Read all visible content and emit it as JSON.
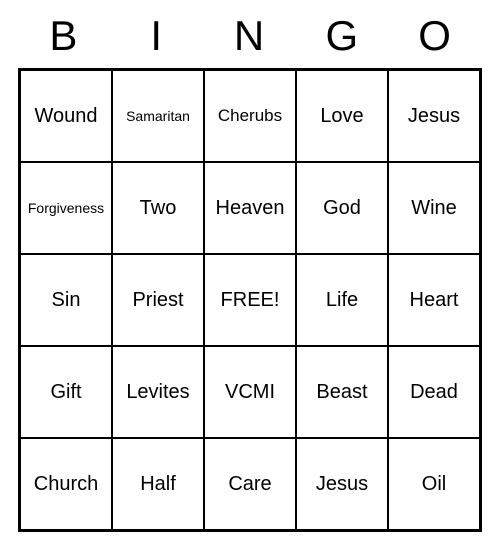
{
  "header": [
    "B",
    "I",
    "N",
    "G",
    "O"
  ],
  "grid": {
    "rows": [
      [
        {
          "text": "Wound",
          "size": "normal"
        },
        {
          "text": "Samaritan",
          "size": "small"
        },
        {
          "text": "Cherubs",
          "size": "medium"
        },
        {
          "text": "Love",
          "size": "normal"
        },
        {
          "text": "Jesus",
          "size": "normal"
        }
      ],
      [
        {
          "text": "Forgiveness",
          "size": "small"
        },
        {
          "text": "Two",
          "size": "normal"
        },
        {
          "text": "Heaven",
          "size": "normal"
        },
        {
          "text": "God",
          "size": "normal"
        },
        {
          "text": "Wine",
          "size": "normal"
        }
      ],
      [
        {
          "text": "Sin",
          "size": "normal"
        },
        {
          "text": "Priest",
          "size": "normal"
        },
        {
          "text": "FREE!",
          "size": "normal"
        },
        {
          "text": "Life",
          "size": "normal"
        },
        {
          "text": "Heart",
          "size": "normal"
        }
      ],
      [
        {
          "text": "Gift",
          "size": "normal"
        },
        {
          "text": "Levites",
          "size": "normal"
        },
        {
          "text": "VCMI",
          "size": "normal"
        },
        {
          "text": "Beast",
          "size": "normal"
        },
        {
          "text": "Dead",
          "size": "normal"
        }
      ],
      [
        {
          "text": "Church",
          "size": "normal"
        },
        {
          "text": "Half",
          "size": "normal"
        },
        {
          "text": "Care",
          "size": "normal"
        },
        {
          "text": "Jesus",
          "size": "normal"
        },
        {
          "text": "Oil",
          "size": "normal"
        }
      ]
    ]
  }
}
